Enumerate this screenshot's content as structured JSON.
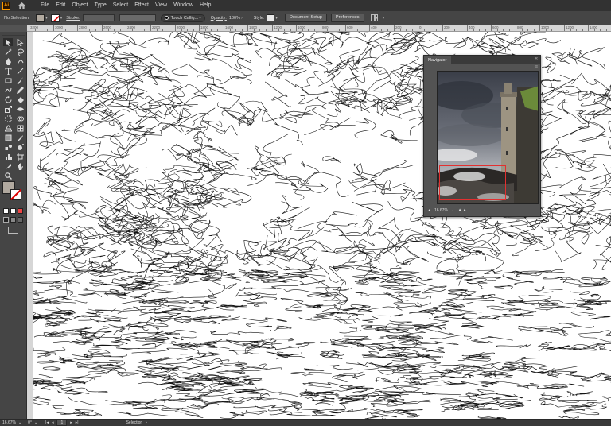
{
  "app": {
    "logo_text": "Ai"
  },
  "menu": [
    "File",
    "Edit",
    "Object",
    "Type",
    "Select",
    "Effect",
    "View",
    "Window",
    "Help"
  ],
  "controlbar": {
    "selection_state": "No Selection",
    "fill_color": "#b1a99f",
    "stroke_label": "Stroke:",
    "brush_name": "Touch Callig...",
    "opacity_label": "Opacity:",
    "opacity_value": "100%",
    "style_label": "Style:",
    "doc_setup_button": "Document Setup",
    "preferences_button": "Preferences"
  },
  "ruler": {
    "ticks": [
      "3200",
      "3000",
      "2800",
      "2600",
      "2400",
      "2200",
      "2000",
      "1800",
      "1600",
      "1400",
      "1200",
      "1000",
      "800",
      "600",
      "400",
      "200",
      "0",
      "200",
      "400",
      "600",
      "800",
      "1000",
      "1200",
      "1400"
    ]
  },
  "toolbar": {
    "tools": [
      "selection-tool",
      "direct-selection-tool",
      "magic-wand-tool",
      "lasso-tool",
      "pen-tool",
      "curvature-tool",
      "type-tool",
      "line-segment-tool",
      "rectangle-tool",
      "paintbrush-tool",
      "shaper-tool",
      "pencil-tool",
      "rotate-tool",
      "eraser-tool",
      "scale-tool",
      "width-tool",
      "free-transform-tool",
      "shape-builder-tool",
      "perspective-grid-tool",
      "mesh-tool",
      "gradient-tool",
      "eyedropper-tool",
      "blend-tool",
      "symbol-sprayer-tool",
      "graph-tool",
      "artboard-tool",
      "slice-tool",
      "hand-tool",
      "zoom-tool"
    ],
    "fill_color": "#b1a99f",
    "stroke_color": "#ffffff",
    "more_label": "···"
  },
  "navigator": {
    "tab_label": "Navigator",
    "close_label": "«",
    "zoom_value": "16.67%"
  },
  "statusbar": {
    "zoom_value": "16.67%",
    "rotation_value": "0°",
    "artboard_number": "1",
    "tool_name": "Selection"
  },
  "colors": {
    "ui_dark": "#323232",
    "ui_panel": "#454545",
    "canvas": "#ffffff",
    "navigator_frame": "#e23030"
  }
}
